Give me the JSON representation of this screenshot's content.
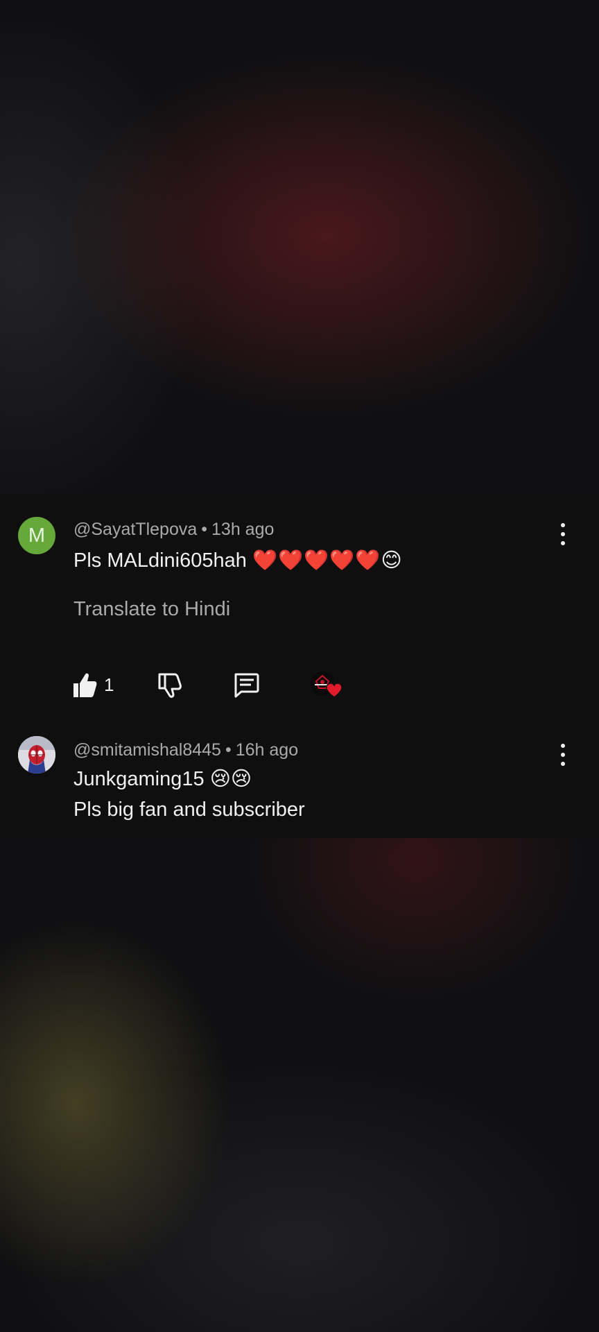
{
  "comments": [
    {
      "avatar_letter": "M",
      "avatar_color": "#67a83a",
      "handle": "@SayatTlepova",
      "time": "13h ago",
      "text_main": "Pls MALdini605hah",
      "text_emoji": "❤️❤️❤️❤️❤️😊",
      "translate_label": "Translate to Hindi",
      "like_count": "1",
      "actions": [
        "like-icon",
        "dislike-icon",
        "reply-icon",
        "creator-heart-icon"
      ]
    },
    {
      "avatar_icon": "spiderman-avatar",
      "handle": "@smitamishal8445",
      "time": "16h ago",
      "line1_main": "Junkgaming15",
      "line1_emoji": "😢😢",
      "line2": "Pls big fan and subscriber"
    }
  ],
  "separator": "•",
  "colors": {
    "panel": "#0f0f0f",
    "secondary_text": "#aaaaaa",
    "primary_text": "#f1f1f1",
    "heart_red": "#e21b2c"
  }
}
